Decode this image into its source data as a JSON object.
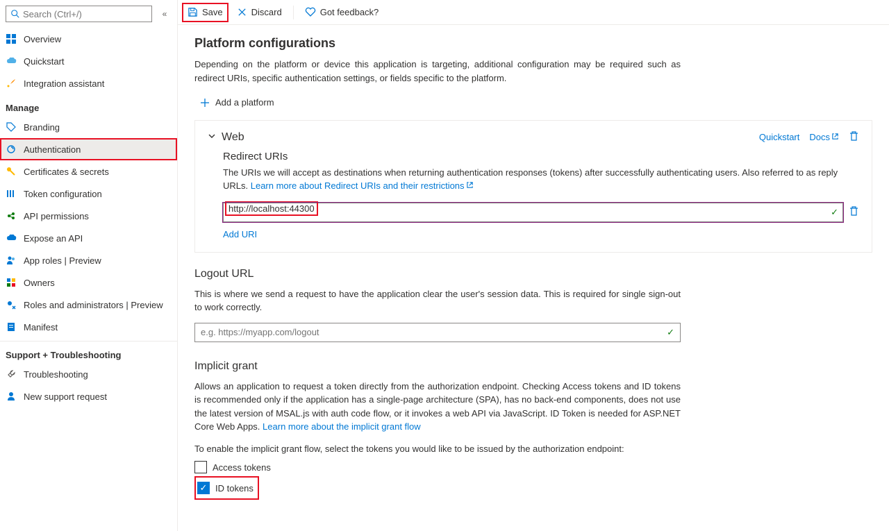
{
  "search": {
    "placeholder": "Search (Ctrl+/)"
  },
  "nav": {
    "items_top": [
      {
        "label": "Overview"
      },
      {
        "label": "Quickstart"
      },
      {
        "label": "Integration assistant"
      }
    ],
    "group_manage": "Manage",
    "items_manage": [
      {
        "label": "Branding"
      },
      {
        "label": "Authentication"
      },
      {
        "label": "Certificates & secrets"
      },
      {
        "label": "Token configuration"
      },
      {
        "label": "API permissions"
      },
      {
        "label": "Expose an API"
      },
      {
        "label": "App roles | Preview"
      },
      {
        "label": "Owners"
      },
      {
        "label": "Roles and administrators | Preview"
      },
      {
        "label": "Manifest"
      }
    ],
    "group_support": "Support + Troubleshooting",
    "items_support": [
      {
        "label": "Troubleshooting"
      },
      {
        "label": "New support request"
      }
    ]
  },
  "cmdbar": {
    "save": "Save",
    "discard": "Discard",
    "feedback": "Got feedback?"
  },
  "platform": {
    "title": "Platform configurations",
    "desc": "Depending on the platform or device this application is targeting, additional configuration may be required such as redirect URIs, specific authentication settings, or fields specific to the platform.",
    "add": "Add a platform"
  },
  "web": {
    "title": "Web",
    "quickstart": "Quickstart",
    "docs": "Docs",
    "redirect_title": "Redirect URIs",
    "redirect_desc": "The URIs we will accept as destinations when returning authentication responses (tokens) after successfully authenticating users. Also referred to as reply URLs. ",
    "redirect_link": "Learn more about Redirect URIs and their restrictions",
    "uri_value": "http://localhost:44300",
    "add_uri": "Add URI"
  },
  "logout": {
    "title": "Logout URL",
    "desc": "This is where we send a request to have the application clear the user's session data. This is required for single sign-out to work correctly.",
    "placeholder": "e.g. https://myapp.com/logout"
  },
  "implicit": {
    "title": "Implicit grant",
    "desc": "Allows an application to request a token directly from the authorization endpoint. Checking Access tokens and ID tokens is recommended only if the application has a single-page architecture (SPA), has no back-end components, does not use the latest version of MSAL.js with auth code flow, or it invokes a web API via JavaScript. ID Token is needed for ASP.NET Core Web Apps. ",
    "link": "Learn more about the implicit grant flow",
    "enable_text": "To enable the implicit grant flow, select the tokens you would like to be issued by the authorization endpoint:",
    "access_tokens": "Access tokens",
    "id_tokens": "ID tokens"
  }
}
